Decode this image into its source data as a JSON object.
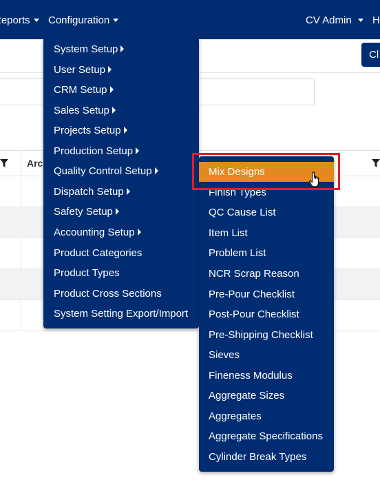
{
  "navbar": {
    "reports_label": "Reports",
    "configuration_label": "Configuration",
    "user_label": "CV Admin",
    "help_label": "H"
  },
  "page": {
    "close_button_label": "Cl",
    "column_header": "Arc"
  },
  "config_menu": {
    "items": [
      {
        "label": "System Setup",
        "has_submenu": true
      },
      {
        "label": "User Setup",
        "has_submenu": true
      },
      {
        "label": "CRM Setup",
        "has_submenu": true
      },
      {
        "label": "Sales Setup",
        "has_submenu": true
      },
      {
        "label": "Projects Setup",
        "has_submenu": true
      },
      {
        "label": "Production Setup",
        "has_submenu": true
      },
      {
        "label": "Quality Control Setup",
        "has_submenu": true
      },
      {
        "label": "Dispatch Setup",
        "has_submenu": true
      },
      {
        "label": "Safety Setup",
        "has_submenu": true
      },
      {
        "label": "Accounting Setup",
        "has_submenu": true
      },
      {
        "label": "Product Categories",
        "has_submenu": false
      },
      {
        "label": "Product Types",
        "has_submenu": false
      },
      {
        "label": "Product Cross Sections",
        "has_submenu": false
      },
      {
        "label": "System Setting Export/Import",
        "has_submenu": false
      }
    ]
  },
  "qc_submenu": {
    "items": [
      "Mix Designs",
      "Finish Types",
      "QC Cause List",
      "Item List",
      "Problem List",
      "NCR Scrap Reason",
      "Pre-Pour Checklist",
      "Post-Pour Checklist",
      "Pre-Shipping Checklist",
      "Sieves",
      "Fineness Modulus",
      "Aggregate Sizes",
      "Aggregates",
      "Aggregate Specifications",
      "Cylinder Break Types"
    ],
    "highlighted_item": "Mix Designs"
  },
  "colors": {
    "navbar": "#002d72",
    "menu": "#002d72",
    "highlight": "#e4891f",
    "focus_border": "#e01e26"
  },
  "icons": {
    "filter": "filter-icon",
    "cursor": "hand-pointer-icon"
  }
}
